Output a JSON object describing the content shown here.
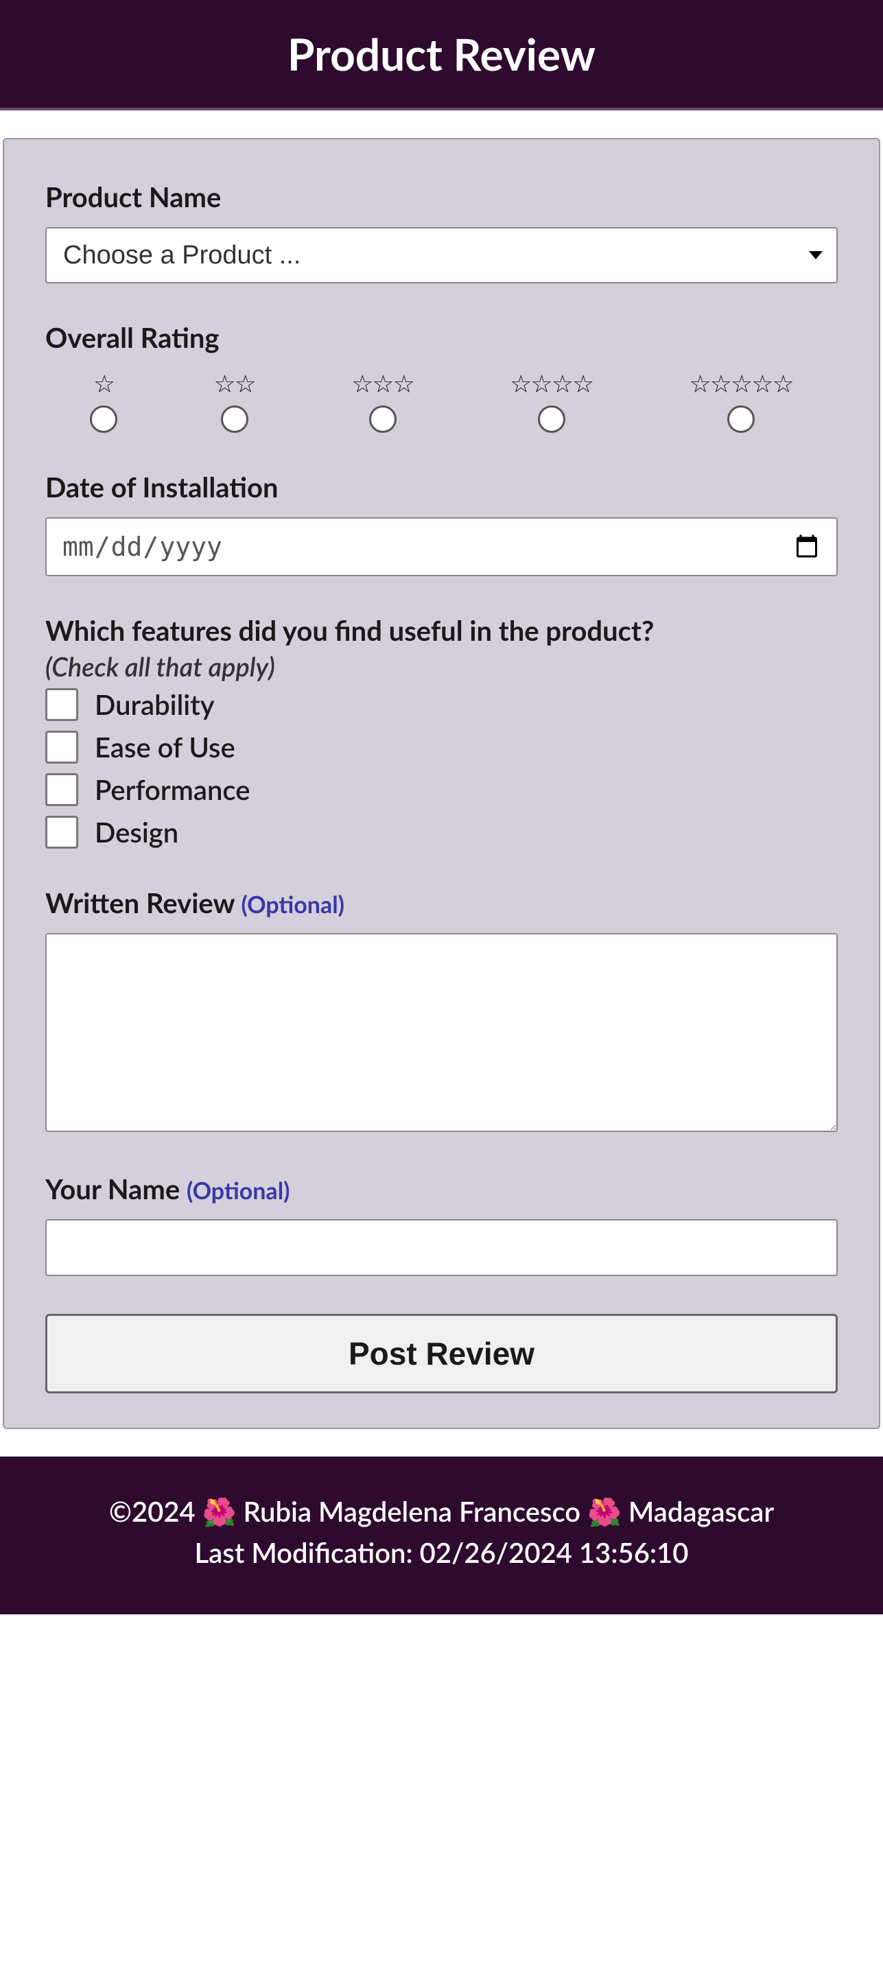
{
  "header": {
    "title": "Product Review"
  },
  "form": {
    "productName": {
      "label": "Product Name",
      "placeholder": "Choose a Product ..."
    },
    "overallRating": {
      "label": "Overall Rating",
      "options": [
        "☆",
        "☆☆",
        "☆☆☆",
        "☆☆☆☆",
        "☆☆☆☆☆"
      ]
    },
    "installDate": {
      "label": "Date of Installation",
      "placeholder": "mm / dd / yyyy"
    },
    "features": {
      "label": "Which features did you find useful in the product?",
      "subtext": "(Check all that apply)",
      "options": [
        "Durability",
        "Ease of Use",
        "Performance",
        "Design"
      ]
    },
    "writtenReview": {
      "label": "Written Review",
      "optional": "(Optional)"
    },
    "yourName": {
      "label": "Your Name",
      "optional": "(Optional)"
    },
    "submit": {
      "label": "Post Review"
    }
  },
  "footer": {
    "line1": "©2024 🌺 Rubia Magdelena Francesco 🌺 Madagascar",
    "line2": "Last Modification: 02/26/2024 13:56:10"
  }
}
